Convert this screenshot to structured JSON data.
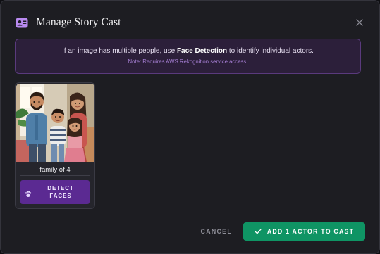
{
  "dialog": {
    "title": "Manage Story Cast",
    "title_icon": "id-card-icon",
    "close_icon": "close-icon"
  },
  "notice": {
    "prefix": "If an image has multiple people, use ",
    "emphasis": "Face Detection",
    "suffix": " to identify individual actors.",
    "note": "Note: Requires AWS Rekognition service access."
  },
  "cast": [
    {
      "label": "family of 4",
      "detect_label_line1": "DETECT",
      "detect_label_line2": "FACES",
      "detect_icon": "paw-icon"
    }
  ],
  "footer": {
    "cancel_label": "CANCEL",
    "primary_label": "ADD 1 ACTOR TO CAST",
    "primary_icon": "check-icon"
  },
  "colors": {
    "dialog_bg": "#1d1d22",
    "accent_purple": "#5b2a92",
    "notice_bg": "#2c1f3a",
    "primary_green": "#0f9464"
  }
}
